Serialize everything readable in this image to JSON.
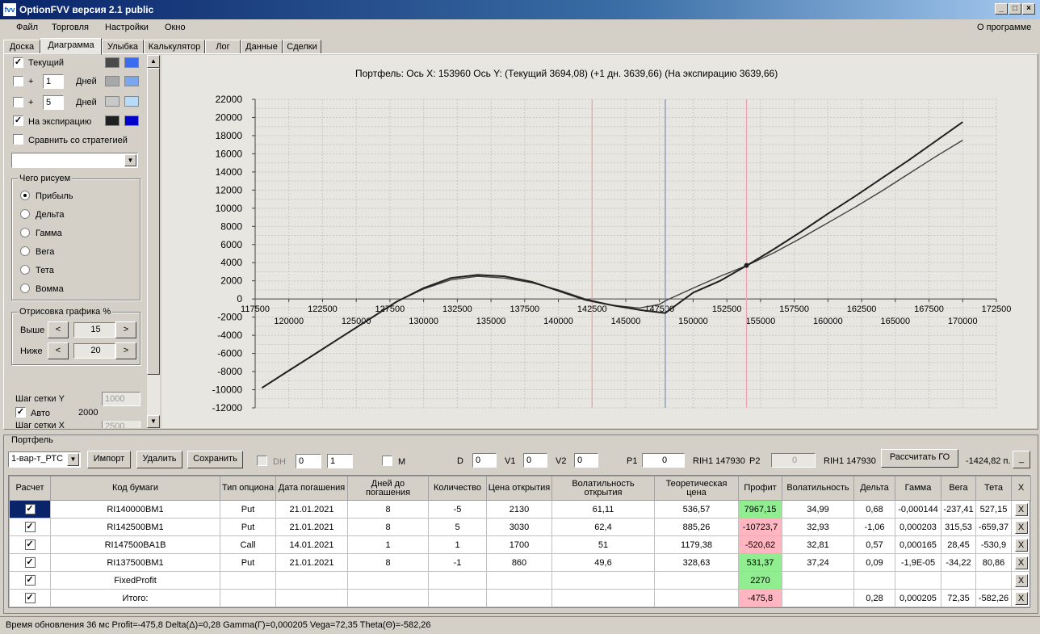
{
  "window": {
    "title": "OptionFVV версия 2.1 public",
    "icon_glyph": "fvv"
  },
  "menu": {
    "items": [
      "Файл",
      "Торговля",
      "Настройки",
      "Окно"
    ],
    "about": "О программе"
  },
  "tabs": [
    "Доска",
    "Диаграмма",
    "Улыбка",
    "Калькулятор",
    "Лог",
    "Данные",
    "Сделки"
  ],
  "left": {
    "current_label": "Текущий",
    "plus": "+",
    "days_label": "Дней",
    "days1": "1",
    "days2": "5",
    "expiry_label": "На экспирацию",
    "compare_label": "Сравнить со стратегией",
    "what_group": "Чего рисуем",
    "radio": [
      "Прибыль",
      "Дельта",
      "Гамма",
      "Вега",
      "Тета",
      "Вомма"
    ],
    "draw_group": "Отрисовка графика %",
    "above_label": "Выше",
    "above_value": "15",
    "below_label": "Ниже",
    "below_value": "20",
    "grid_y_label": "Шаг сетки Y",
    "grid_y_value": "1000",
    "auto_label": "Авто",
    "auto_value": "2000",
    "grid_x_label": "Шаг сетки X",
    "grid_x_value": "2500",
    "arrow_left": "<",
    "arrow_right": ">",
    "colors": {
      "current_dark": "#4a4a4a",
      "current_light": "#3a6cf0",
      "d1_dark": "#a8a8a8",
      "d1_light": "#7aa6f0",
      "d2_dark": "#c8c8c8",
      "d2_light": "#b8dcf8",
      "exp_dark": "#202020",
      "exp_light": "#0000c8"
    }
  },
  "chart_title": "Портфель:  Ось X:  153960  Ось Y:   (Текущий 3694,08)   (+1 дн. 3639,66)   (На экспирацию 3639,66)",
  "chart_data": {
    "type": "line",
    "x_ticks_top": [
      117500,
      122500,
      127500,
      132500,
      137500,
      142500,
      147500,
      152500,
      157500,
      162500,
      167500,
      172500
    ],
    "x_ticks_bottom": [
      120000,
      125000,
      130000,
      135000,
      140000,
      145000,
      150000,
      155000,
      160000,
      165000,
      170000
    ],
    "y_ticks": [
      22000,
      20000,
      18000,
      16000,
      14000,
      12000,
      10000,
      8000,
      6000,
      4000,
      2000,
      0,
      -2000,
      -4000,
      -6000,
      -8000,
      -10000,
      -12000
    ],
    "xlim": [
      117500,
      172500
    ],
    "ylim": [
      -12000,
      22000
    ],
    "grid": true,
    "vlines": [
      {
        "x": 142500,
        "color": "#f0a0a0"
      },
      {
        "x": 147930,
        "color": "#7090c0"
      },
      {
        "x": 153960,
        "color": "#f0a0b0"
      }
    ],
    "marker": {
      "x": 153960,
      "y": 3694
    },
    "series": [
      {
        "style": "current",
        "color": "#404040",
        "x": [
          118000,
          120000,
          122000,
          124000,
          126000,
          128000,
          130000,
          132000,
          134000,
          136000,
          138000,
          140000,
          142000,
          144000,
          146000,
          147500,
          148000,
          150000,
          152000,
          154000,
          156000,
          158000,
          160000,
          162000,
          164000,
          166000,
          168000,
          170000
        ],
        "y": [
          -9800,
          -7900,
          -6000,
          -4100,
          -2200,
          -300,
          1100,
          2100,
          2500,
          2300,
          1800,
          1000,
          0,
          -700,
          -1000,
          -600,
          -150,
          1200,
          2500,
          3700,
          5100,
          6700,
          8400,
          10100,
          11900,
          13800,
          15700,
          17500
        ]
      },
      {
        "style": "expiry",
        "color": "#202020",
        "x": [
          118000,
          120000,
          122000,
          124000,
          126000,
          128000,
          130000,
          132000,
          134000,
          136000,
          138000,
          140000,
          142000,
          144000,
          146000,
          147930,
          150000,
          152000,
          154000,
          156000,
          158000,
          160000,
          162000,
          164000,
          166000,
          168000,
          170000
        ],
        "y": [
          -9800,
          -7900,
          -6000,
          -4100,
          -2200,
          -300,
          1200,
          2300,
          2650,
          2500,
          1900,
          900,
          -100,
          -700,
          -1200,
          -1550,
          700,
          2000,
          3700,
          5500,
          7400,
          9400,
          11300,
          13300,
          15300,
          17400,
          19500
        ]
      }
    ]
  },
  "portfolio": {
    "group": "Портфель",
    "select": "1-вар-т_РТС",
    "import": "Импорт",
    "delete": "Удалить",
    "save": "Сохранить",
    "dh": "DH",
    "dh_val1": "0",
    "dh_val2": "1",
    "m": "M",
    "d_label": "D",
    "d_val": "0",
    "v1_label": "V1",
    "v1_val": "0",
    "v2_label": "V2",
    "v2_val": "0",
    "p1_label": "P1",
    "p1_val": "0",
    "rih1": "RIH1 147930",
    "p2_label": "P2",
    "p2_val": "0",
    "rih2": "RIH1 147930",
    "calc": "Рассчитать ГО",
    "go_value": "-1424,82 п.",
    "min_btn": "_"
  },
  "table": {
    "headers": [
      "Расчет",
      "Код бумаги",
      "Тип опциона",
      "Дата погашения",
      "Дней до погашения",
      "Количество",
      "Цена открытия",
      "Волатильность открытия",
      "Теоретическая цена",
      "Профит",
      "Волатильность",
      "Дельта",
      "Гамма",
      "Вега",
      "Тета",
      "X"
    ],
    "rows": [
      {
        "code": "RI140000BM1",
        "type": "Put",
        "date": "21.01.2021",
        "days": "8",
        "qty": "-5",
        "price": "2130",
        "vol_open": "61,11",
        "theo": "536,57",
        "profit": "7967,15",
        "profit_color": "#90ee90",
        "vol": "34,99",
        "delta": "0,68",
        "gamma": "-0,000144",
        "vega": "-237,41",
        "theta": "527,15",
        "x": "X"
      },
      {
        "code": "RI142500BM1",
        "type": "Put",
        "date": "21.01.2021",
        "days": "8",
        "qty": "5",
        "price": "3030",
        "vol_open": "62,4",
        "theo": "885,26",
        "profit": "-10723,7",
        "profit_color": "#ffb6c1",
        "vol": "32,93",
        "delta": "-1,06",
        "gamma": "0,000203",
        "vega": "315,53",
        "theta": "-659,37",
        "x": "X"
      },
      {
        "code": "RI147500BA1B",
        "type": "Call",
        "date": "14.01.2021",
        "days": "1",
        "qty": "1",
        "price": "1700",
        "vol_open": "51",
        "theo": "1179,38",
        "profit": "-520,62",
        "profit_color": "#ffb6c1",
        "vol": "32,81",
        "delta": "0,57",
        "gamma": "0,000165",
        "vega": "28,45",
        "theta": "-530,9",
        "x": "X"
      },
      {
        "code": "RI137500BM1",
        "type": "Put",
        "date": "21.01.2021",
        "days": "8",
        "qty": "-1",
        "price": "860",
        "vol_open": "49,6",
        "theo": "328,63",
        "profit": "531,37",
        "profit_color": "#90ee90",
        "vol": "37,24",
        "delta": "0,09",
        "gamma": "-1,9E-05",
        "vega": "-34,22",
        "theta": "80,86",
        "x": "X"
      },
      {
        "code": "FixedProfit",
        "type": "",
        "date": "",
        "days": "",
        "qty": "",
        "price": "",
        "vol_open": "",
        "theo": "",
        "profit": "2270",
        "profit_color": "#90ee90",
        "vol": "",
        "delta": "",
        "gamma": "",
        "vega": "",
        "theta": "",
        "x": "X"
      },
      {
        "code": "Итого:",
        "type": "",
        "date": "",
        "days": "",
        "qty": "",
        "price": "",
        "vol_open": "",
        "theo": "",
        "profit": "-475,8",
        "profit_color": "#ffb6c1",
        "vol": "",
        "delta": "0,28",
        "gamma": "0,000205",
        "vega": "72,35",
        "theta": "-582,26",
        "x": "X"
      }
    ]
  },
  "status": "Время обновления 36 мс   Profit=-475,8 Delta(Δ)=0,28 Gamma(Г)=0,000205 Vega=72,35 Theta(Θ)=-582,26"
}
